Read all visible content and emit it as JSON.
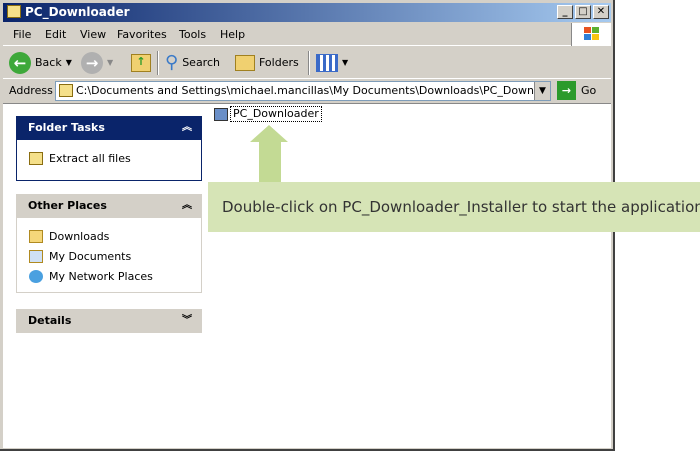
{
  "window": {
    "title": "PC_Downloader"
  },
  "menu": [
    "File",
    "Edit",
    "View",
    "Favorites",
    "Tools",
    "Help"
  ],
  "toolbar": {
    "back": "Back",
    "search": "Search",
    "folders": "Folders"
  },
  "address": {
    "label": "Address",
    "value": "C:\\Documents and Settings\\michael.mancillas\\My Documents\\Downloads\\PC_Downloader.zip",
    "go": "Go"
  },
  "folder_tasks": {
    "title": "Folder Tasks",
    "items": [
      "Extract all files"
    ]
  },
  "other_places": {
    "title": "Other Places",
    "items": [
      "Downloads",
      "My Documents",
      "My Network Places"
    ]
  },
  "details": {
    "title": "Details"
  },
  "file": {
    "name": "PC_Downloader"
  },
  "callout": {
    "text": "Double-click on PC_Downloader_Installer to start the application.",
    "color": "#d6e4b6"
  }
}
